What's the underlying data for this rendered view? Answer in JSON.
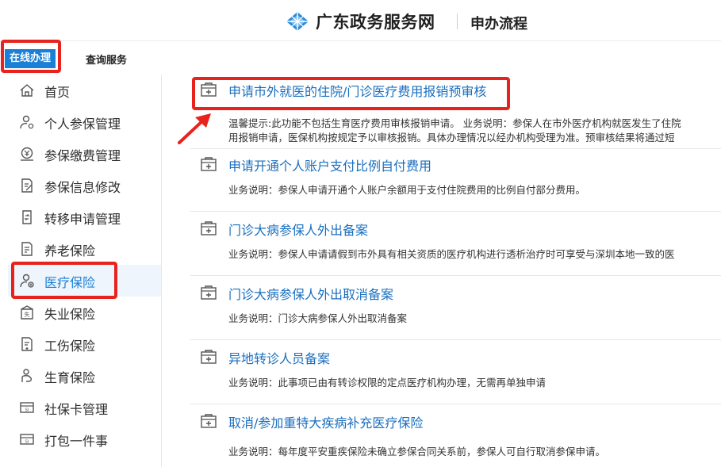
{
  "header": {
    "brand": "广东政务服务网",
    "page_title": "申办流程"
  },
  "tabs": {
    "online": "在线办理",
    "query": "查询服务"
  },
  "sidebar": {
    "items": [
      {
        "label": "首页",
        "icon": "home-icon"
      },
      {
        "label": "个人参保管理",
        "icon": "person-settings-icon"
      },
      {
        "label": "参保缴费管理",
        "icon": "payment-icon"
      },
      {
        "label": "参保信息修改",
        "icon": "edit-document-icon"
      },
      {
        "label": "转移申请管理",
        "icon": "transfer-document-icon"
      },
      {
        "label": "养老保险",
        "icon": "pension-document-icon"
      },
      {
        "label": "医疗保险",
        "icon": "medical-person-icon",
        "active": true
      },
      {
        "label": "失业保险",
        "icon": "unemployment-icon"
      },
      {
        "label": "工伤保险",
        "icon": "injury-document-icon"
      },
      {
        "label": "生育保险",
        "icon": "maternity-icon"
      },
      {
        "label": "社保卡管理",
        "icon": "social-card-icon"
      },
      {
        "label": "打包一件事",
        "icon": "package-card-icon"
      }
    ]
  },
  "services": [
    {
      "title": "申请市外就医的住院/门诊医疗费用报销预审核",
      "desc1": "温馨提示:此功能不包括生育医疗费用审核报销申请。 业务说明：参保人在市外医疗机构就医发生了住院",
      "desc2": "用报销申请，医保机构按规定予以审核报销。具体办理情况以经办机构受理为准。预审核结果将通过短"
    },
    {
      "title": "申请开通个人账户支付比例自付费用",
      "desc1": "业务说明：参保人申请开通个人账户余额用于支付住院费用的比例自付部分费用。"
    },
    {
      "title": "门诊大病参保人外出备案",
      "desc1": "业务说明：参保人申请请假到市外具有相关资质的医疗机构进行透析治疗时可享受与深圳本地一致的医"
    },
    {
      "title": "门诊大病参保人外出取消备案",
      "desc1": "业务说明：门诊大病参保人外出取消备案"
    },
    {
      "title": "异地转诊人员备案",
      "desc1": "业务说明：此事项已由有转诊权限的定点医疗机构办理，无需再单独申请"
    },
    {
      "title": "取消/参加重特大疾病补充医疗保险",
      "desc1": "业务说明：每年度平安重疾保险未确立参保合同关系前，参保人可自行取消参保申请。"
    }
  ],
  "colors": {
    "brand_blue": "#1a7fd6",
    "link_blue": "#1a6fbf",
    "highlight_red": "#e8231e"
  }
}
